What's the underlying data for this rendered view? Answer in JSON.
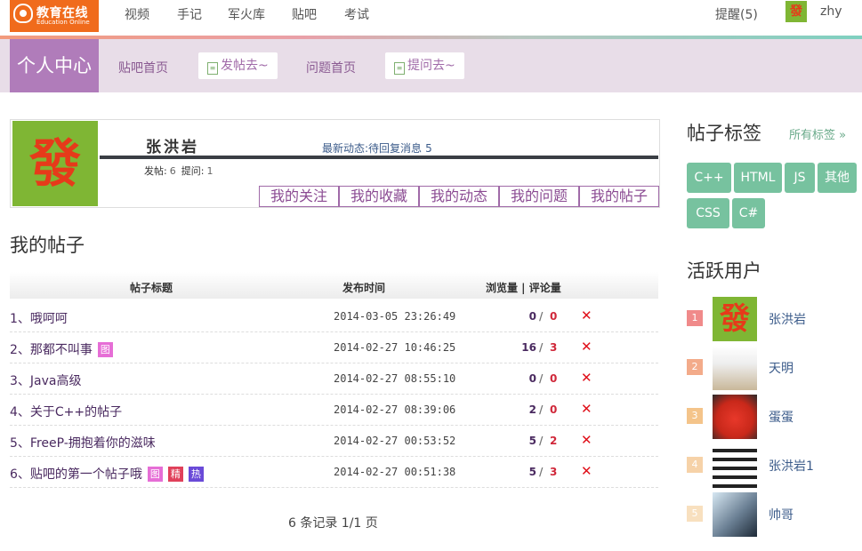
{
  "topbar": {
    "logo_name": "教育在线",
    "logo_sub": "Education Online",
    "nav": [
      "视频",
      "手记",
      "军火库",
      "贴吧",
      "考试"
    ],
    "remind": "提醒(5)",
    "avatar_char": "發",
    "username": "zhy"
  },
  "subbar": {
    "title": "个人中心",
    "link1": "贴吧首页",
    "btn1": "发帖去~",
    "link2": "问题首页",
    "btn2": "提问去~"
  },
  "profile": {
    "avatar_char": "發",
    "name": "张洪岩",
    "latest_label": "最新动态:",
    "latest_text": "待回复消息",
    "latest_count": "5",
    "posts_label": "发帖:",
    "posts": "6",
    "questions_label": "提问:",
    "questions": "1",
    "tabs": [
      "我的关注",
      "我的收藏",
      "我的动态",
      "我的问题",
      "我的帖子"
    ]
  },
  "posts": {
    "title": "我的帖子",
    "headers": {
      "title": "帖子标题",
      "time": "发布时间",
      "stats": "浏览量 | 评论量"
    },
    "rows": [
      {
        "title": "1、哦呵呵",
        "time": "2014-03-05 23:26:49",
        "views": "0",
        "comments": "0",
        "badges": []
      },
      {
        "title": "2、那都不叫事",
        "time": "2014-02-27 10:46:25",
        "views": "16",
        "comments": "3",
        "badges": [
          "图"
        ]
      },
      {
        "title": "3、Java高级",
        "time": "2014-02-27 08:55:10",
        "views": "0",
        "comments": "0",
        "badges": []
      },
      {
        "title": "4、关于C++的帖子",
        "time": "2014-02-27 08:39:06",
        "views": "2",
        "comments": "0",
        "badges": []
      },
      {
        "title": "5、FreeP-拥抱着你的滋味",
        "time": "2014-02-27 00:53:52",
        "views": "5",
        "comments": "2",
        "badges": []
      },
      {
        "title": "6、贴吧的第一个帖子哦",
        "time": "2014-02-27 00:51:38",
        "views": "5",
        "comments": "3",
        "badges": [
          "图",
          "精",
          "热"
        ]
      }
    ],
    "delete_symbol": "✕",
    "pager": "6 条记录 1/1 页"
  },
  "badge_colors": {
    "图": "#e66ed6",
    "精": "#e0405a",
    "热": "#6a4ad8"
  },
  "tags": {
    "title": "帖子标签",
    "all_link": "所有标签 »",
    "items": [
      "C++",
      "HTML",
      "JS",
      "其他",
      "CSS",
      "C#"
    ]
  },
  "active_users": {
    "title": "活跃用户",
    "rank_colors": [
      "#f08a8a",
      "#f3ab8a",
      "#f4c48a",
      "#f6d2a8",
      "#f8e0bf"
    ],
    "users": [
      {
        "rank": "1",
        "name": "张洪岩"
      },
      {
        "rank": "2",
        "name": "天明"
      },
      {
        "rank": "3",
        "name": "蛋蛋"
      },
      {
        "rank": "4",
        "name": "张洪岩1"
      },
      {
        "rank": "5",
        "name": "帅哥"
      }
    ]
  }
}
